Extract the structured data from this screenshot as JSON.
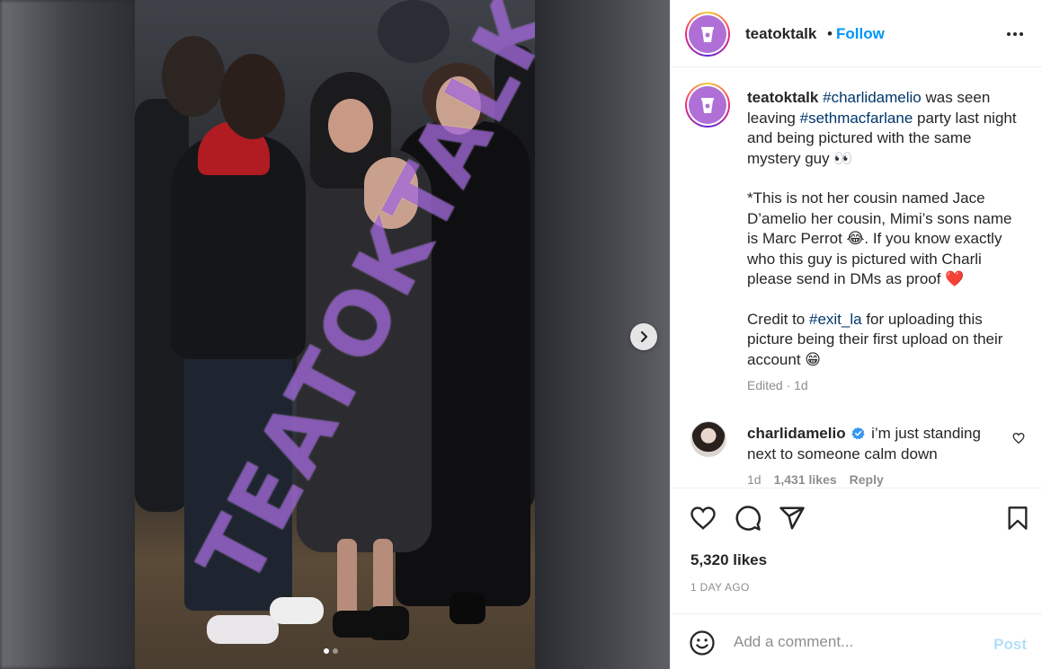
{
  "post": {
    "account": "teatoktalk",
    "separator": "•",
    "follow_label": "Follow",
    "watermark": "TEATOKTALK",
    "media_dots": 2,
    "caption": {
      "username": "teatoktalk",
      "para1_tag1": "#charlidamelio",
      "para1_mid": " was seen leaving ",
      "para1_tag2": "#sethmacfarlane",
      "para1_end": " party last night and being pictured with the same mystery guy 👀",
      "para2": "*This is not her cousin named Jace D’amelio her cousin, Mimi’s sons name is Marc Perrot 😂. If you know exactly who this guy is pictured with Charli please send in DMs as proof ❤️",
      "para3_start": "Credit to ",
      "para3_tag": "#exit_la",
      "para3_end": " for uploading this picture being their first upload on their account 😁",
      "meta": "Edited · 1d"
    },
    "comment": {
      "username": "charlidamelio",
      "text": "i’m just standing next to someone calm down",
      "age": "1d",
      "likes": "1,431 likes",
      "reply": "Reply"
    },
    "likes": "5,320 likes",
    "posted": "1 DAY AGO",
    "add_comment": {
      "placeholder": "Add a comment...",
      "post_label": "Post"
    }
  },
  "icons": {
    "more": "more-horizontal-icon",
    "next": "chevron-right-icon",
    "like": "heart-icon",
    "comment": "comment-icon",
    "share": "paper-plane-icon",
    "save": "bookmark-icon",
    "emoji": "smiley-icon",
    "verified": "verified-badge-icon"
  },
  "colors": {
    "link": "#0095f6",
    "hashtag": "#00376b",
    "post_disabled": "#b2dffc",
    "watermark": "#8c46d2"
  }
}
